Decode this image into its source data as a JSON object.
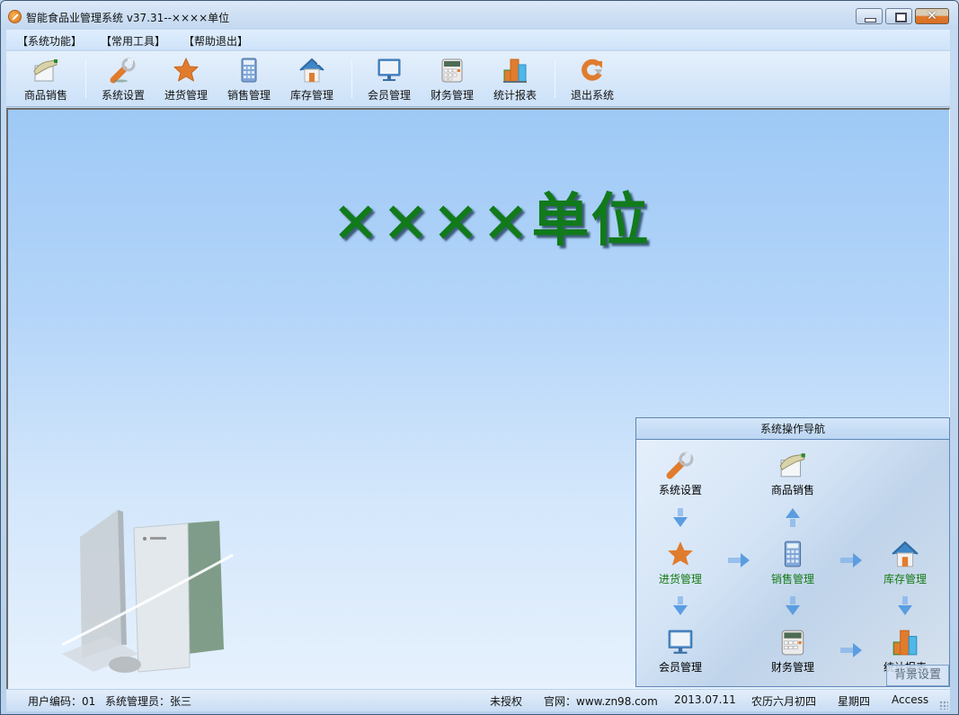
{
  "window": {
    "title": "智能食品业管理系统 v37.31--××××单位",
    "controls": {
      "minimize": "minimize",
      "maximize": "maximize",
      "close": "✕"
    }
  },
  "menubar": {
    "items": [
      {
        "label": "【系统功能】"
      },
      {
        "label": "【常用工具】"
      },
      {
        "label": "【帮助退出】"
      }
    ]
  },
  "toolbar": {
    "items": [
      {
        "label": "商品销售",
        "icon": "hand-card-icon"
      },
      {
        "label": "系统设置",
        "icon": "wrench-icon"
      },
      {
        "label": "进货管理",
        "icon": "star-icon"
      },
      {
        "label": "销售管理",
        "icon": "calculator-icon"
      },
      {
        "label": "库存管理",
        "icon": "house-icon"
      },
      {
        "label": "会员管理",
        "icon": "monitor-icon"
      },
      {
        "label": "财务管理",
        "icon": "cash-register-icon"
      },
      {
        "label": "统计报表",
        "icon": "bar-chart-icon"
      },
      {
        "label": "退出系统",
        "icon": "exit-icon"
      }
    ]
  },
  "main": {
    "unit_title": "××××单位"
  },
  "nav_panel": {
    "title": "系统操作导航",
    "nodes": [
      {
        "label": "系统设置",
        "icon": "wrench-icon"
      },
      {
        "label": "商品销售",
        "icon": "hand-card-icon"
      },
      {
        "label": "进货管理",
        "icon": "star-icon"
      },
      {
        "label": "销售管理",
        "icon": "calculator-icon"
      },
      {
        "label": "库存管理",
        "icon": "house-icon"
      },
      {
        "label": "会员管理",
        "icon": "monitor-icon"
      },
      {
        "label": "财务管理",
        "icon": "cash-register-icon"
      },
      {
        "label": "统计报表",
        "icon": "bar-chart-icon"
      }
    ],
    "bg_button": "背景设置"
  },
  "statusbar": {
    "user_code": "用户编码：01",
    "operator": "系统管理员：张三",
    "license": "未授权",
    "website": "官网：www.zn98.com",
    "date": "2013.07.11",
    "lunar": "农历六月初四",
    "weekday": "星期四",
    "db": "Access"
  },
  "colors": {
    "accent_green": "#117a1b",
    "icon_orange": "#e07c2e",
    "close_button": "#d96f22"
  }
}
